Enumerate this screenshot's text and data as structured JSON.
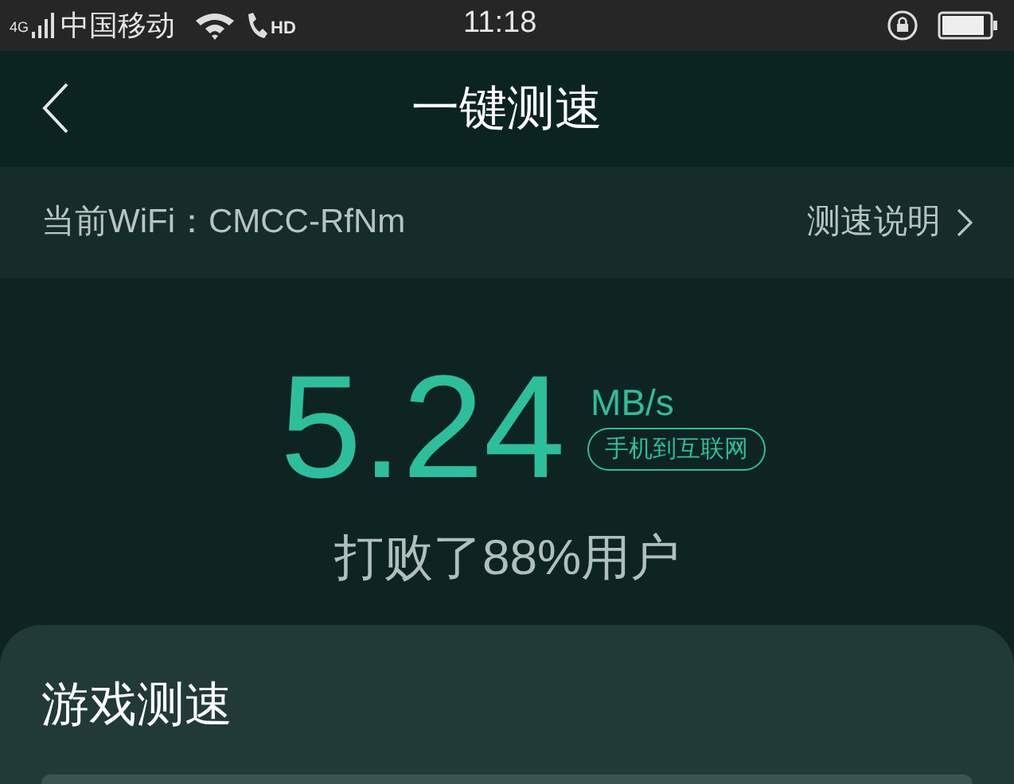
{
  "status_bar": {
    "network": "4G",
    "carrier": "中国移动",
    "call_badge": "HD",
    "time": "11:18"
  },
  "header": {
    "title": "一键测速"
  },
  "wifi_bar": {
    "label": "当前WiFi：CMCC-RfNm",
    "link": "测速说明"
  },
  "result": {
    "speed": "5.24",
    "unit": "MB/s",
    "scope": "手机到互联网",
    "rank": "打败了88%用户"
  },
  "card": {
    "title": "游戏测速"
  }
}
